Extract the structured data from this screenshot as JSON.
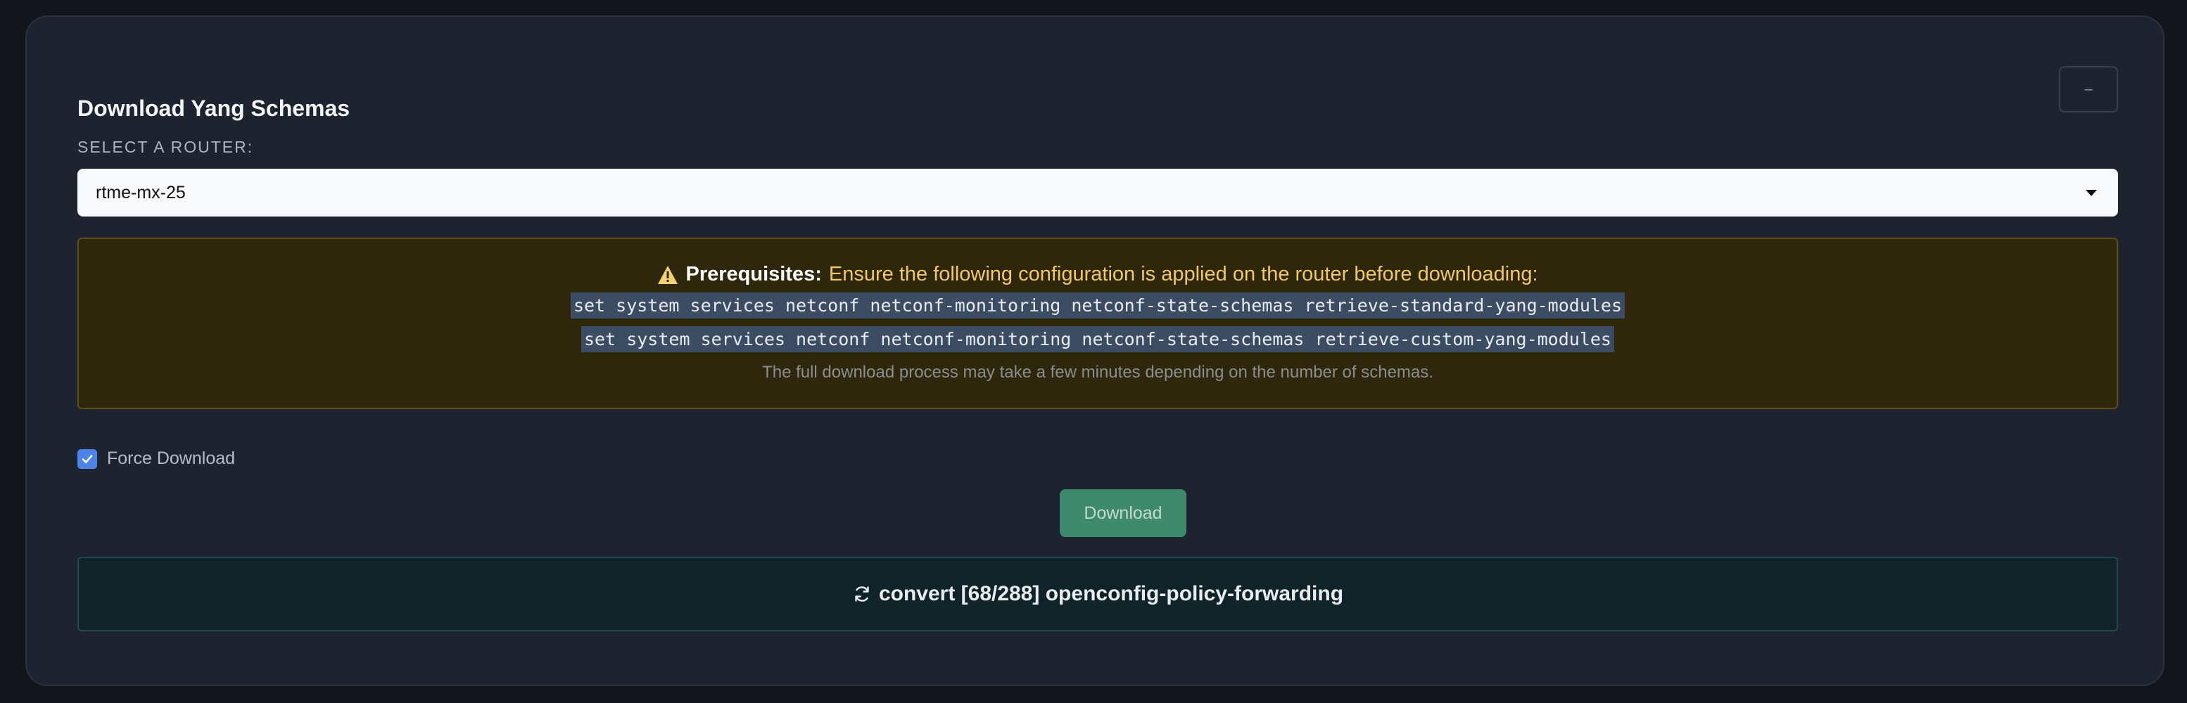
{
  "panel": {
    "title": "Download Yang Schemas",
    "collapse_label": "–"
  },
  "router": {
    "label": "SELECT A ROUTER:",
    "selected": "rtme-mx-25"
  },
  "prerequisites": {
    "heading": "Prerequisites:",
    "message": "Ensure the following configuration is applied on the router before downloading:",
    "commands": [
      "set system services netconf netconf-monitoring netconf-state-schemas retrieve-standard-yang-modules",
      "set system services netconf netconf-monitoring netconf-state-schemas retrieve-custom-yang-modules"
    ],
    "note": "The full download process may take a few minutes depending on the number of schemas."
  },
  "force_download": {
    "label": "Force Download",
    "checked": true
  },
  "download_button": {
    "label": "Download"
  },
  "status": {
    "text": "convert [68/288] openconfig-policy-forwarding"
  },
  "colors": {
    "panel_bg": "#1e2330",
    "warning_bg": "#2e270c",
    "warning_text": "#f1c76a",
    "accent_blue": "#4d84e8",
    "button_green": "#3f8a6d",
    "status_bg": "#0f2329"
  },
  "icons": {
    "warning": "warning-triangle-icon",
    "checkbox": "check-icon",
    "status": "sync-icon",
    "select": "caret-down-icon"
  }
}
